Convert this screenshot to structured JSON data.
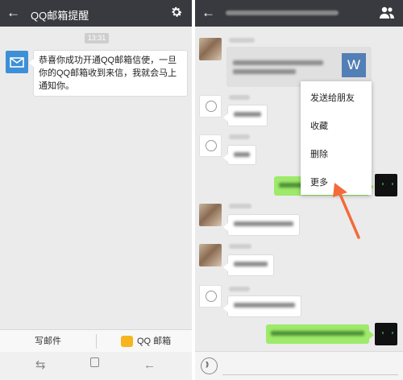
{
  "left_screen": {
    "header": {
      "back_icon": "back-arrow-icon",
      "title": "QQ邮箱提醒",
      "settings_icon": "gear-icon"
    },
    "timestamp": "13:31",
    "message": {
      "avatar_icon": "mail-envelope-icon",
      "text": "恭喜你成功开通QQ邮箱信使，一旦你的QQ邮箱收到来信，我就会马上通知你。"
    },
    "bottom_tabs": {
      "compose_label": "写邮件",
      "qqmail_label": "QQ 邮箱",
      "qqmail_icon": "qq-mail-icon"
    },
    "nav_icons": [
      "recent-apps-icon",
      "home-icon",
      "back-icon"
    ]
  },
  "right_screen": {
    "header": {
      "back_icon": "back-arrow-icon",
      "profile_icon": "group-profile-icon"
    },
    "file_card": {
      "letter": "W",
      "icon": "word-file-icon"
    },
    "context_menu": {
      "items": [
        "发送给朋友",
        "收藏",
        "删除",
        "更多"
      ]
    },
    "input_bar": {
      "voice_icon": "voice-input-icon"
    },
    "colors": {
      "header_bg": "#393a3f",
      "chat_bg": "#ebebeb",
      "bubble_green": "#9eea6a",
      "annotation_arrow": "#f36b3b",
      "word_blue": "#527fb5"
    }
  }
}
